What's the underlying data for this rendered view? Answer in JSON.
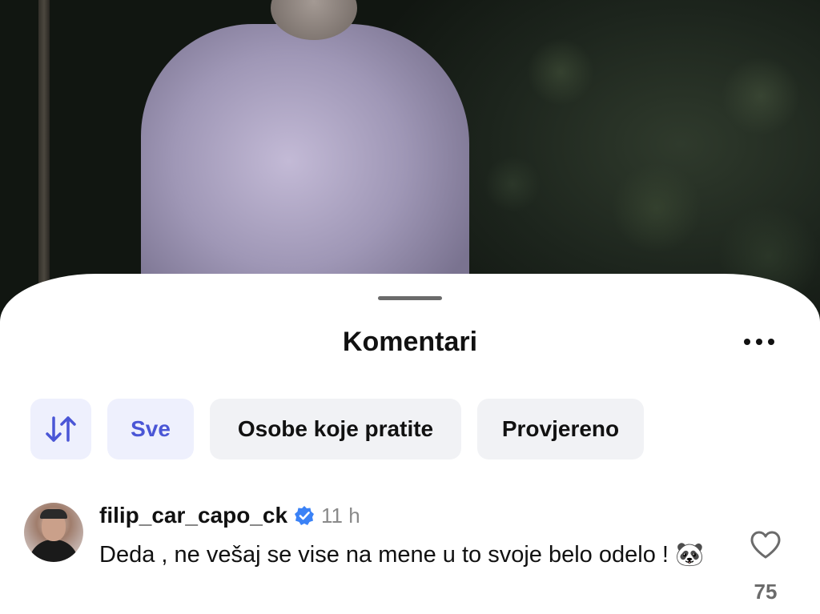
{
  "sheet": {
    "title": "Komentari",
    "more_icon": "more-horizontal-icon"
  },
  "filters": {
    "sort_icon": "sort-up-down-icon",
    "items": [
      {
        "label": "Sve",
        "active": true
      },
      {
        "label": "Osobe koje pratite",
        "active": false
      },
      {
        "label": "Provjereno",
        "active": false
      }
    ],
    "accent_color": "#4a56d6"
  },
  "comment": {
    "username": "filip_car_capo_ck",
    "verified": true,
    "verified_color": "#3b82f6",
    "time": "11 h",
    "text": "Deda , ne vešaj se vise na mene u to svoje belo odelo ! 🐼",
    "likes": "75"
  }
}
